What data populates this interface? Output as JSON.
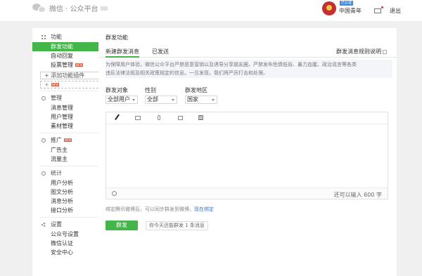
{
  "header": {
    "logo_text": "微信 · 公众平台",
    "verified_tag": "已认证",
    "user_name": "中国青年",
    "logout": "退出"
  },
  "sidebar": {
    "groups": [
      {
        "title": "功能",
        "icon": "grid-icon",
        "items": [
          {
            "label": "群发功能",
            "active": true
          },
          {
            "label": "自动回复"
          },
          {
            "label": "投票管理",
            "badge": "NEW"
          }
        ]
      },
      {
        "title": "管理",
        "icon": "circle-icon",
        "items": [
          {
            "label": "消息管理"
          },
          {
            "label": "用户管理"
          },
          {
            "label": "素材管理"
          }
        ]
      },
      {
        "title": "推广",
        "icon": "circle-icon",
        "badge": "NEW",
        "items": [
          {
            "label": "广告主"
          },
          {
            "label": "流量主"
          }
        ]
      },
      {
        "title": "统计",
        "icon": "circle-icon",
        "items": [
          {
            "label": "用户分析"
          },
          {
            "label": "图文分析"
          },
          {
            "label": "消息分析"
          },
          {
            "label": "接口分析"
          }
        ]
      },
      {
        "title": "设置",
        "icon": "gear-icon",
        "items": [
          {
            "label": "公众号设置"
          },
          {
            "label": "微信认证"
          },
          {
            "label": "安全中心"
          }
        ]
      }
    ],
    "add_plugin": "+ 添加功能插件",
    "plugin_slot": "+",
    "plugin_badge": "NEW"
  },
  "main": {
    "page_title": "群发功能",
    "tabs": [
      "新建群发消息",
      "已发送"
    ],
    "rule_link": "群发消息规则说明",
    "notice_line1": "为保障用户体验，微信公众平台严禁恶意营销以及诱导分享朋友圈，严禁发布色情低俗、暴力血腥、政治谣言等各类",
    "notice_line2": "违反法律法规及相关政策规定的信息。一旦发现，我们将严厉打击和处理。",
    "filters": [
      {
        "label": "群发对象",
        "value": "全部用户"
      },
      {
        "label": "性别",
        "value": "全部"
      },
      {
        "label": "群发地区",
        "value": "国家"
      }
    ],
    "char_count": "还可以输入 600 字",
    "weibo_text": "绑定腾讯微博后，可以同步群发到微博，",
    "weibo_link": "现在绑定",
    "send_label": "群发",
    "quota_text": "你今天还能群发 1 条消息"
  }
}
